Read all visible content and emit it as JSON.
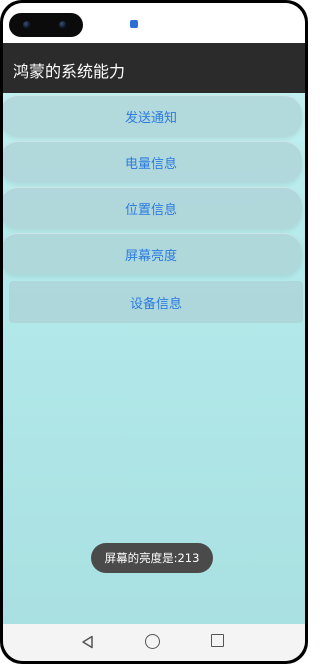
{
  "app": {
    "title": "鸿蒙的系统能力"
  },
  "buttons": [
    {
      "label": "发送通知"
    },
    {
      "label": "电量信息"
    },
    {
      "label": "位置信息"
    },
    {
      "label": "屏幕亮度"
    },
    {
      "label": "设备信息"
    }
  ],
  "toast": {
    "text": "屏幕的亮度是:213"
  },
  "navigation": {
    "back_icon": "back-triangle-icon",
    "home_icon": "home-circle-icon",
    "recent_icon": "recent-square-icon"
  },
  "colors": {
    "accent_text": "#2d7be0",
    "app_bar": "#2b2b2b",
    "background_top": "#c9f3f4",
    "background_bottom": "#a8dfe0",
    "toast_bg": "#4a4a4a"
  }
}
